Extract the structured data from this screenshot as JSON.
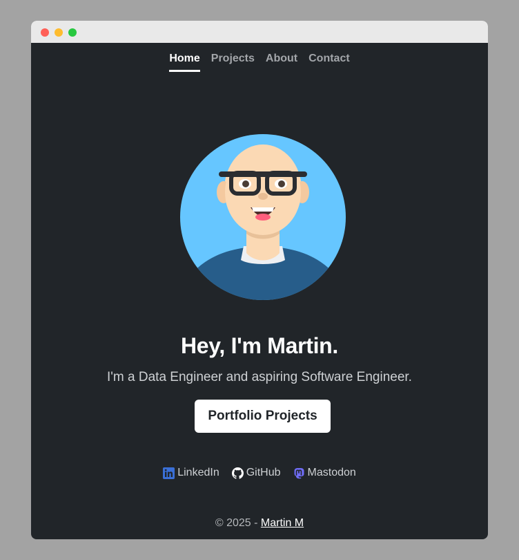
{
  "nav": {
    "items": [
      {
        "label": "Home",
        "active": true
      },
      {
        "label": "Projects",
        "active": false
      },
      {
        "label": "About",
        "active": false
      },
      {
        "label": "Contact",
        "active": false
      }
    ]
  },
  "hero": {
    "avatar_icon": "cartoon-avatar-bald-man-with-glasses",
    "headline": "Hey, I'm Martin.",
    "subline": "I'm a Data Engineer and aspiring Software Engineer.",
    "cta_label": "Portfolio Projects"
  },
  "social": {
    "links": [
      {
        "label": "LinkedIn",
        "icon": "linkedin-icon",
        "color": "#3a6fd6"
      },
      {
        "label": "GitHub",
        "icon": "github-icon",
        "color": "#ffffff"
      },
      {
        "label": "Mastodon",
        "icon": "mastodon-icon",
        "color": "#6f6cf5"
      }
    ]
  },
  "footer": {
    "copyright": "© 2025 - ",
    "author_link": "Martin M"
  },
  "colors": {
    "page_bg": "#212529",
    "outer_bg": "#a3a3a3",
    "avatar_bg": "#66c6ff",
    "sweater": "#275d8a"
  }
}
